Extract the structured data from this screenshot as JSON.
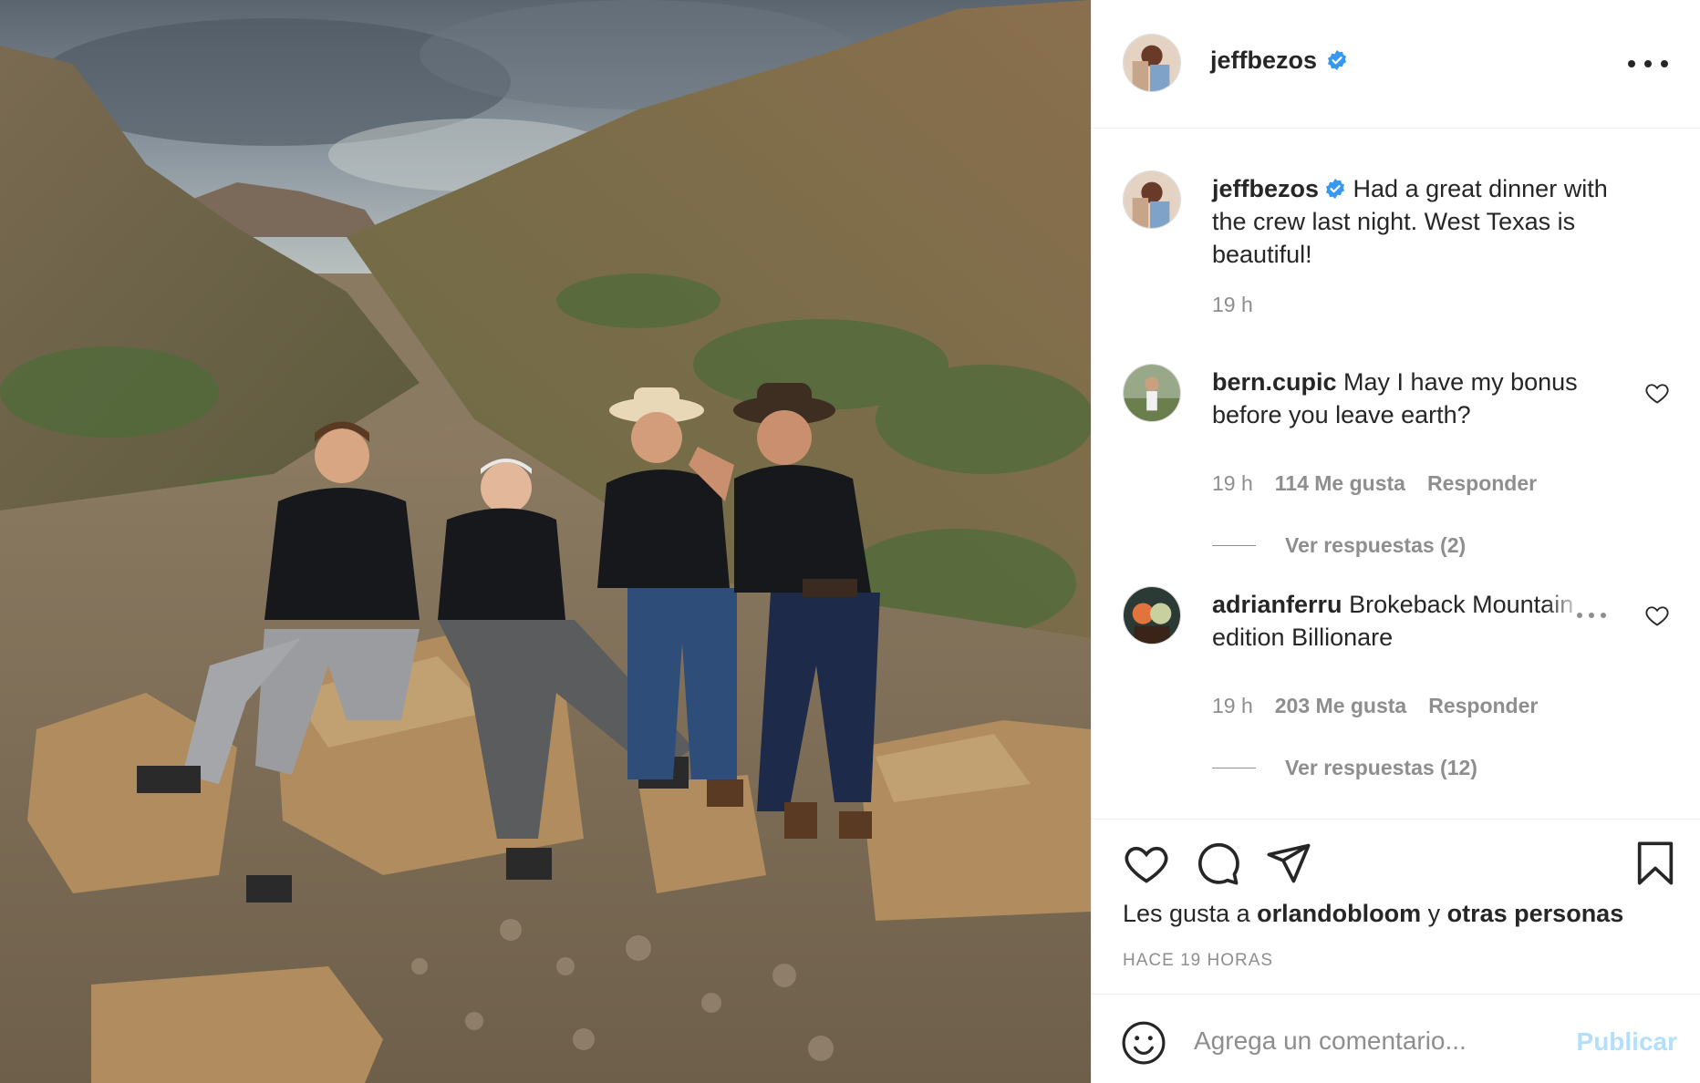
{
  "post": {
    "author": "jeffbezos",
    "caption": "Had a great dinner with the crew last night. West Texas is beautiful!",
    "caption_time": "19 h",
    "likes_prefix": "Les gusta a",
    "likes_user": "orlandobloom",
    "likes_connector": "y",
    "likes_others": "otras personas",
    "time_ago": "HACE 19 HORAS"
  },
  "comments": [
    {
      "user": "bern.cupic",
      "text": "May I have my bonus before you leave earth?",
      "time": "19 h",
      "likes": "114 Me gusta",
      "reply": "Responder",
      "view_replies": "Ver respuestas (2)"
    },
    {
      "user": "adrianferru",
      "text_a": "Brokeback Moun",
      "text_fade": "tain",
      "text_b": "edition Billionare",
      "time": "19 h",
      "likes": "203 Me gusta",
      "reply": "Responder",
      "view_replies": "Ver respuestas (12)"
    }
  ],
  "add_comment": {
    "placeholder": "Agrega un comentario...",
    "publish": "Publicar"
  },
  "colors": {
    "verified": "#3897f0",
    "text": "#262626",
    "muted": "#8e8e8e",
    "publish_disabled": "#b2dffc",
    "border": "#efefef"
  },
  "icons": [
    "verified-badge-icon",
    "more-options-icon",
    "heart-icon",
    "comment-icon",
    "share-icon",
    "bookmark-icon",
    "emoji-icon"
  ]
}
